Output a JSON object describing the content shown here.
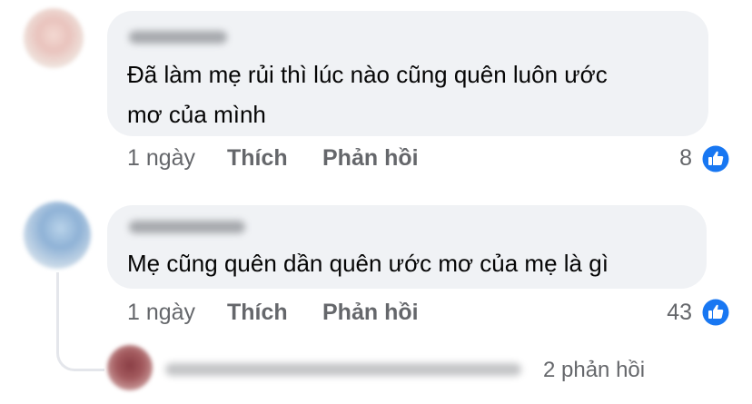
{
  "comments": [
    {
      "text_line1": "Đã làm mẹ rủi thì lúc nào cũng quên luôn ước",
      "text_line2": "mơ của mình",
      "time": "1 ngày",
      "like_label": "Thích",
      "reply_label": "Phản hồi",
      "reaction_count": "8"
    },
    {
      "text_line1": "Mẹ cũng quên dần quên ước mơ của mẹ là gì",
      "time": "1 ngày",
      "like_label": "Thích",
      "reply_label": "Phản hồi",
      "reaction_count": "43"
    }
  ],
  "reply_thread": {
    "replies_label": "2 phản hồi"
  },
  "icons": {
    "reaction": "like-thumb-icon",
    "reaction_color": "#1877f2"
  }
}
